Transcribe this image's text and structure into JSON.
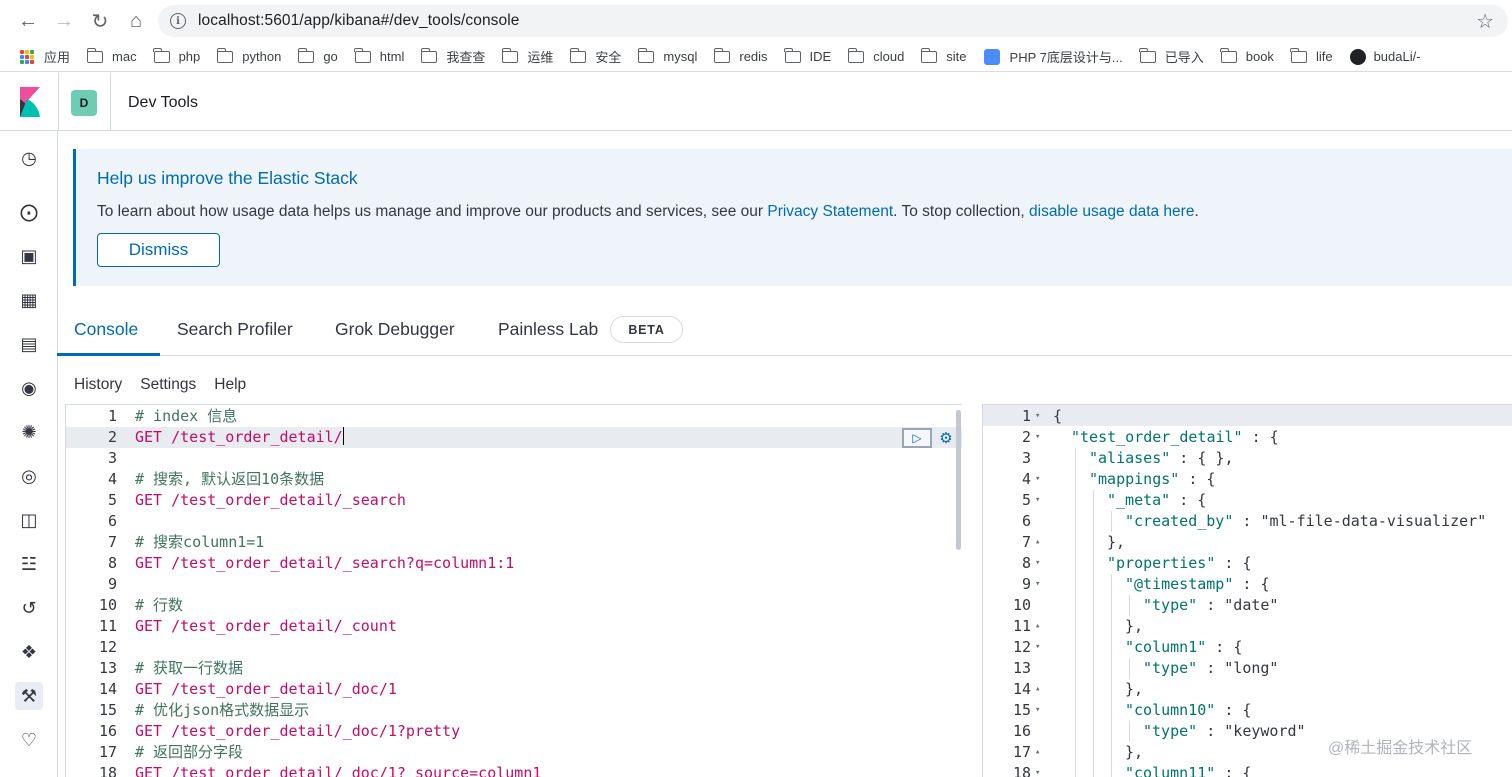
{
  "browser": {
    "url": "localhost:5601/app/kibana#/dev_tools/console",
    "bookmarks": [
      "应用",
      "mac",
      "php",
      "python",
      "go",
      "html",
      "我查查",
      "运维",
      "安全",
      "mysql",
      "redis",
      "IDE",
      "cloud",
      "site",
      "PHP 7底层设计与...",
      "已导入",
      "book",
      "life",
      "budaLi/-"
    ]
  },
  "header": {
    "space_initial": "D",
    "breadcrumb": "Dev Tools"
  },
  "callout": {
    "title": "Help us improve the Elastic Stack",
    "text_before": "To learn about how usage data helps us manage and improve our products and services, see our ",
    "privacy_link": "Privacy Statement",
    "text_middle": ". To stop collection, ",
    "disable_link": "disable usage data here",
    "text_after": ".",
    "dismiss_label": "Dismiss"
  },
  "tabs": {
    "console": "Console",
    "search_profiler": "Search Profiler",
    "grok_debugger": "Grok Debugger",
    "painless_lab": "Painless Lab",
    "beta_badge": "BETA"
  },
  "menu": {
    "history": "History",
    "settings": "Settings",
    "help": "Help"
  },
  "editor_lines": [
    {
      "n": "1",
      "type": "comment",
      "text": "# index 信息"
    },
    {
      "n": "2",
      "type": "request",
      "method": "GET",
      "path": "/test_order_detail/"
    },
    {
      "n": "3",
      "type": "blank",
      "text": ""
    },
    {
      "n": "4",
      "type": "comment",
      "text": "# 搜索, 默认返回10条数据"
    },
    {
      "n": "5",
      "type": "request",
      "method": "GET",
      "path": "/test_order_detail/_search"
    },
    {
      "n": "6",
      "type": "blank",
      "text": ""
    },
    {
      "n": "7",
      "type": "comment",
      "text": "# 搜索column1=1"
    },
    {
      "n": "8",
      "type": "request",
      "method": "GET",
      "path": "/test_order_detail/_search?q=column1:1"
    },
    {
      "n": "9",
      "type": "blank",
      "text": ""
    },
    {
      "n": "10",
      "type": "comment",
      "text": "# 行数"
    },
    {
      "n": "11",
      "type": "request",
      "method": "GET",
      "path": "/test_order_detail/_count"
    },
    {
      "n": "12",
      "type": "blank",
      "text": ""
    },
    {
      "n": "13",
      "type": "comment",
      "text": "# 获取一行数据"
    },
    {
      "n": "14",
      "type": "request",
      "method": "GET",
      "path": "/test_order_detail/_doc/1"
    },
    {
      "n": "15",
      "type": "comment",
      "text": "# 优化json格式数据显示"
    },
    {
      "n": "16",
      "type": "request",
      "method": "GET",
      "path": "/test_order_detail/_doc/1?pretty"
    },
    {
      "n": "17",
      "type": "comment",
      "text": "# 返回部分字段"
    },
    {
      "n": "18",
      "type": "request",
      "method": "GET",
      "path": "/test_order_detail/_doc/1?_source=column1"
    }
  ],
  "output_lines": [
    {
      "n": "1",
      "fold": "▾",
      "indent": 0,
      "text": "{"
    },
    {
      "n": "2",
      "fold": "▾",
      "indent": 1,
      "key": "\"test_order_detail\"",
      "rest": " : {"
    },
    {
      "n": "3",
      "fold": "",
      "indent": 2,
      "key": "\"aliases\"",
      "rest": " : { },"
    },
    {
      "n": "4",
      "fold": "▾",
      "indent": 2,
      "key": "\"mappings\"",
      "rest": " : {"
    },
    {
      "n": "5",
      "fold": "▾",
      "indent": 3,
      "key": "\"_meta\"",
      "rest": " : {"
    },
    {
      "n": "6",
      "fold": "",
      "indent": 4,
      "key": "\"created_by\"",
      "rest": " : ",
      "value": "\"ml-file-data-visualizer\""
    },
    {
      "n": "7",
      "fold": "▴",
      "indent": 3,
      "text": "},"
    },
    {
      "n": "8",
      "fold": "▾",
      "indent": 3,
      "key": "\"properties\"",
      "rest": " : {"
    },
    {
      "n": "9",
      "fold": "▾",
      "indent": 4,
      "key": "\"@timestamp\"",
      "rest": " : {"
    },
    {
      "n": "10",
      "fold": "",
      "indent": 5,
      "key": "\"type\"",
      "rest": " : ",
      "value": "\"date\""
    },
    {
      "n": "11",
      "fold": "▴",
      "indent": 4,
      "text": "},"
    },
    {
      "n": "12",
      "fold": "▾",
      "indent": 4,
      "key": "\"column1\"",
      "rest": " : {"
    },
    {
      "n": "13",
      "fold": "",
      "indent": 5,
      "key": "\"type\"",
      "rest": " : ",
      "value": "\"long\""
    },
    {
      "n": "14",
      "fold": "▴",
      "indent": 4,
      "text": "},"
    },
    {
      "n": "15",
      "fold": "▾",
      "indent": 4,
      "key": "\"column10\"",
      "rest": " : {"
    },
    {
      "n": "16",
      "fold": "",
      "indent": 5,
      "key": "\"type\"",
      "rest": " : ",
      "value": "\"keyword\""
    },
    {
      "n": "17",
      "fold": "▴",
      "indent": 4,
      "text": "},"
    },
    {
      "n": "18",
      "fold": "▾",
      "indent": 4,
      "key": "\"column11\"",
      "rest": " : {"
    }
  ],
  "watermark": "@稀土掘金技术社区",
  "colors": {
    "accent": "#006bb4",
    "method": "#c80a68",
    "path": "#00756c",
    "comment": "#41755c",
    "space_avatar": "#6dccb1"
  }
}
